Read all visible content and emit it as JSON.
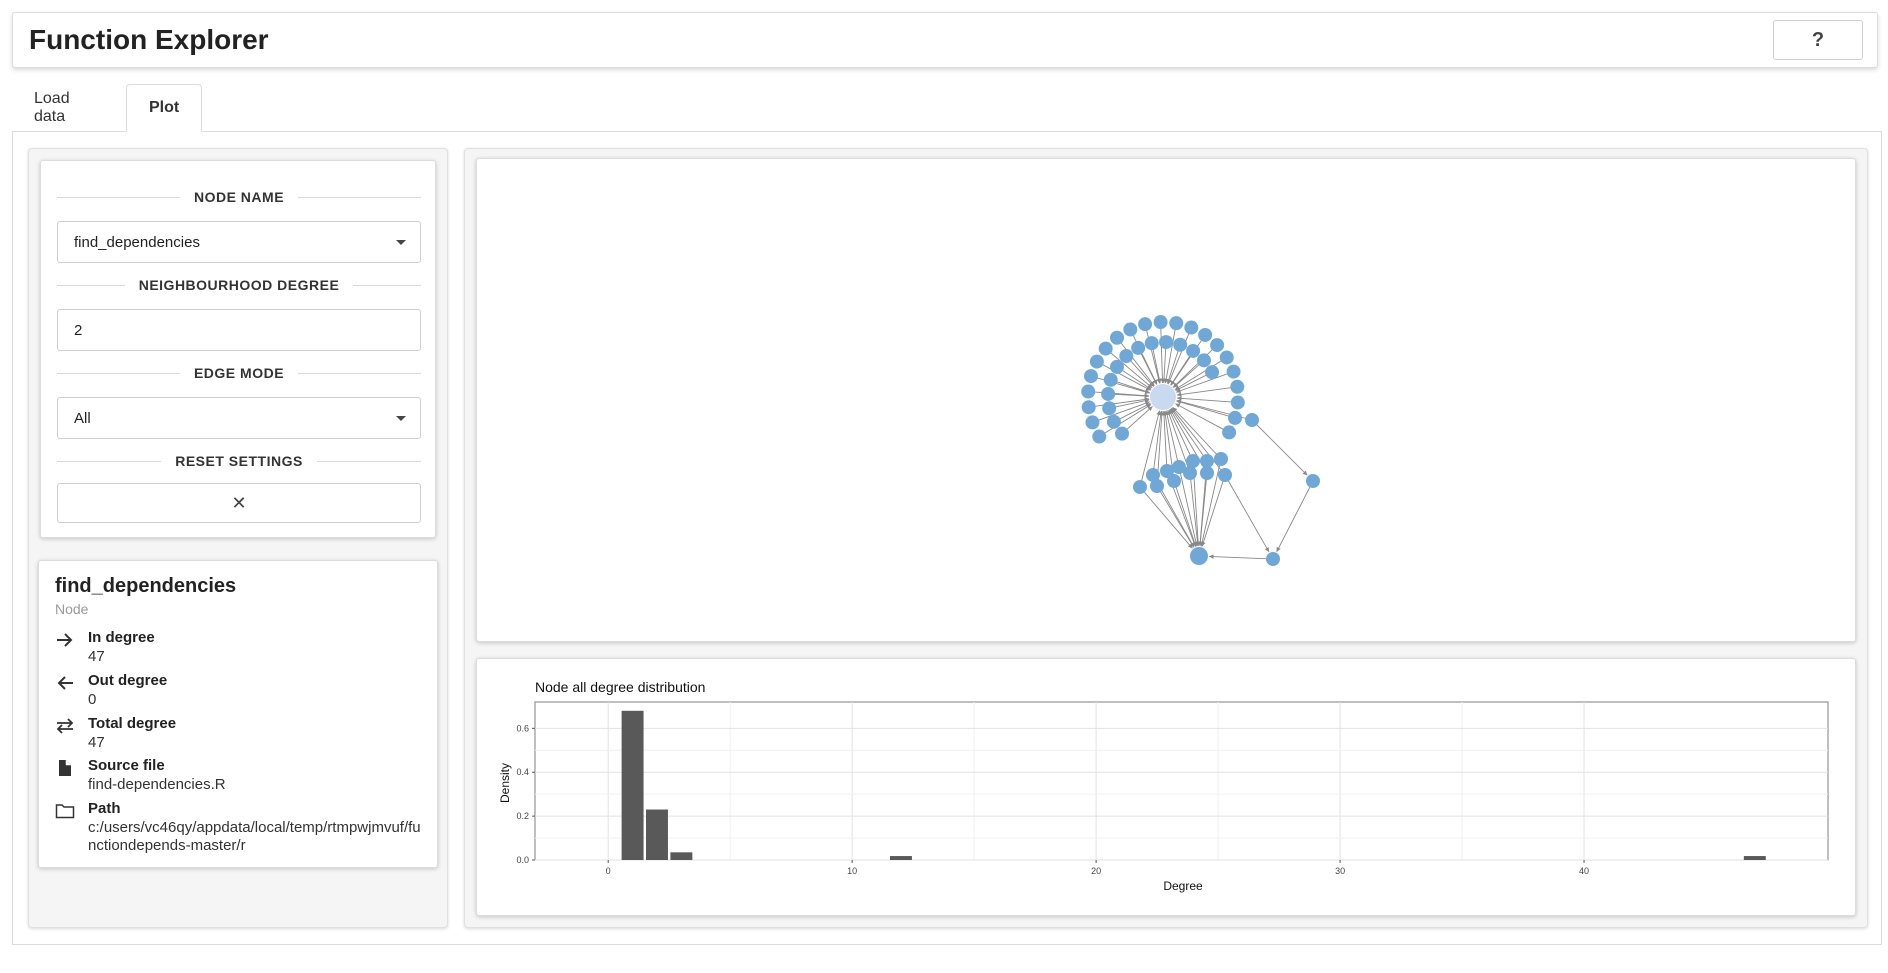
{
  "app": {
    "title": "Function Explorer",
    "help_label": "?"
  },
  "tabs": [
    {
      "label": "Load data",
      "active": false
    },
    {
      "label": "Plot",
      "active": true
    }
  ],
  "controls": {
    "node_name": {
      "label": "NODE NAME",
      "value": "find_dependencies"
    },
    "neighbourhood_degree": {
      "label": "NEIGHBOURHOOD DEGREE",
      "value": "2"
    },
    "edge_mode": {
      "label": "EDGE MODE",
      "value": "All"
    },
    "reset": {
      "label": "RESET SETTINGS",
      "button_glyph": "✕"
    }
  },
  "node_info": {
    "name": "find_dependencies",
    "type": "Node",
    "rows": [
      {
        "icon": "arrow-right-icon",
        "label": "In degree",
        "value": "47"
      },
      {
        "icon": "arrow-left-icon",
        "label": "Out degree",
        "value": "0"
      },
      {
        "icon": "exchange-icon",
        "label": "Total degree",
        "value": "47"
      },
      {
        "icon": "file-icon",
        "label": "Source file",
        "value": "find-dependencies.R"
      },
      {
        "icon": "folder-icon",
        "label": "Path",
        "value": "c:/users/vc46qy/appdata/local/temp/rtmpwjmvuf/functiondepends-master/r"
      }
    ]
  },
  "network": {
    "node_color": "#6fa8d6",
    "selected_node_color": "#c9daf0",
    "edge_color": "#888888"
  },
  "chart_data": {
    "type": "bar",
    "title": "Node all degree distribution",
    "xlabel": "Degree",
    "ylabel": "Density",
    "xlim": [
      -3,
      50
    ],
    "ylim": [
      0,
      0.72
    ],
    "x_ticks": [
      0,
      10,
      20,
      30,
      40
    ],
    "y_ticks": [
      0.0,
      0.2,
      0.4,
      0.6
    ],
    "y_tick_labels": [
      "0.0",
      "0.2",
      "0.4",
      "0.6"
    ],
    "bin_width": 0.9,
    "bars": [
      {
        "x": 1,
        "value": 0.68
      },
      {
        "x": 2,
        "value": 0.23
      },
      {
        "x": 3,
        "value": 0.035
      },
      {
        "x": 12,
        "value": 0.018
      },
      {
        "x": 47,
        "value": 0.018
      }
    ],
    "bar_color": "#595959",
    "grid": true
  }
}
